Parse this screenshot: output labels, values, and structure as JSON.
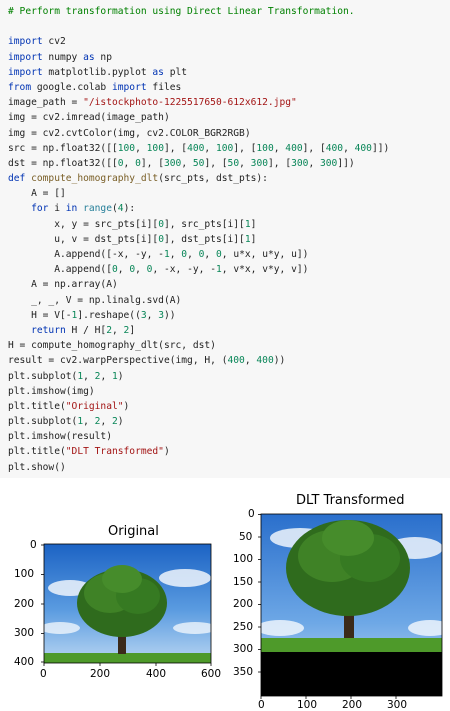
{
  "code": {
    "lines": [
      [
        [
          "com",
          "# Perform transformation using Direct Linear Transformation."
        ]
      ],
      [
        [
          "",
          ""
        ]
      ],
      [
        [
          "kw",
          "import"
        ],
        [
          "",
          " cv2"
        ]
      ],
      [
        [
          "kw",
          "import"
        ],
        [
          "",
          " numpy "
        ],
        [
          "kw",
          "as"
        ],
        [
          "",
          " np"
        ]
      ],
      [
        [
          "kw",
          "import"
        ],
        [
          "",
          " matplotlib.pyplot "
        ],
        [
          "kw",
          "as"
        ],
        [
          "",
          " plt"
        ]
      ],
      [
        [
          "kw",
          "from"
        ],
        [
          "",
          " google.colab "
        ],
        [
          "kw",
          "import"
        ],
        [
          "",
          " files"
        ]
      ],
      [
        [
          "",
          "image_path = "
        ],
        [
          "str",
          "\"/istockphoto-1225517650-612x612.jpg\""
        ]
      ],
      [
        [
          "",
          "img = cv2.imread(image_path)"
        ]
      ],
      [
        [
          "",
          "img = cv2.cvtColor(img, cv2.COLOR_BGR2RGB)"
        ]
      ],
      [
        [
          "",
          "src = np.float32([["
        ],
        [
          "num",
          "100"
        ],
        [
          "",
          ", "
        ],
        [
          "num",
          "100"
        ],
        [
          "",
          "], ["
        ],
        [
          "num",
          "400"
        ],
        [
          "",
          ", "
        ],
        [
          "num",
          "100"
        ],
        [
          "",
          "], ["
        ],
        [
          "num",
          "100"
        ],
        [
          "",
          ", "
        ],
        [
          "num",
          "400"
        ],
        [
          "",
          "], ["
        ],
        [
          "num",
          "400"
        ],
        [
          "",
          ", "
        ],
        [
          "num",
          "400"
        ],
        [
          "",
          "]])"
        ]
      ],
      [
        [
          "",
          "dst = np.float32([["
        ],
        [
          "num",
          "0"
        ],
        [
          "",
          ", "
        ],
        [
          "num",
          "0"
        ],
        [
          "",
          "], ["
        ],
        [
          "num",
          "300"
        ],
        [
          "",
          ", "
        ],
        [
          "num",
          "50"
        ],
        [
          "",
          "], ["
        ],
        [
          "num",
          "50"
        ],
        [
          "",
          ", "
        ],
        [
          "num",
          "300"
        ],
        [
          "",
          "], ["
        ],
        [
          "num",
          "300"
        ],
        [
          "",
          ", "
        ],
        [
          "num",
          "300"
        ],
        [
          "",
          "]])"
        ]
      ],
      [
        [
          "kw",
          "def"
        ],
        [
          "",
          " "
        ],
        [
          "fn",
          "compute_homography_dlt"
        ],
        [
          "",
          "(src_pts, dst_pts):"
        ]
      ],
      [
        [
          "",
          "    A = []"
        ]
      ],
      [
        [
          "",
          "    "
        ],
        [
          "kw",
          "for"
        ],
        [
          "",
          " i "
        ],
        [
          "kw",
          "in"
        ],
        [
          "",
          " "
        ],
        [
          "mod",
          "range"
        ],
        [
          "",
          "("
        ],
        [
          "num",
          "4"
        ],
        [
          "",
          "):"
        ]
      ],
      [
        [
          "",
          "        x, y = src_pts[i]["
        ],
        [
          "num",
          "0"
        ],
        [
          "",
          "], src_pts[i]["
        ],
        [
          "num",
          "1"
        ],
        [
          "",
          "]"
        ]
      ],
      [
        [
          "",
          "        u, v = dst_pts[i]["
        ],
        [
          "num",
          "0"
        ],
        [
          "",
          "], dst_pts[i]["
        ],
        [
          "num",
          "1"
        ],
        [
          "",
          "]"
        ]
      ],
      [
        [
          "",
          "        A.append([-x, -y, -"
        ],
        [
          "num",
          "1"
        ],
        [
          "",
          ", "
        ],
        [
          "num",
          "0"
        ],
        [
          "",
          ", "
        ],
        [
          "num",
          "0"
        ],
        [
          "",
          ", "
        ],
        [
          "num",
          "0"
        ],
        [
          "",
          ", u*x, u*y, u])"
        ]
      ],
      [
        [
          "",
          "        A.append(["
        ],
        [
          "num",
          "0"
        ],
        [
          "",
          ", "
        ],
        [
          "num",
          "0"
        ],
        [
          "",
          ", "
        ],
        [
          "num",
          "0"
        ],
        [
          "",
          ", -x, -y, -"
        ],
        [
          "num",
          "1"
        ],
        [
          "",
          ", v*x, v*y, v])"
        ]
      ],
      [
        [
          "",
          "    A = np.array(A)"
        ]
      ],
      [
        [
          "",
          "    _, _, V = np.linalg.svd(A)"
        ]
      ],
      [
        [
          "",
          "    H = V[-"
        ],
        [
          "num",
          "1"
        ],
        [
          "",
          "].reshape(("
        ],
        [
          "num",
          "3"
        ],
        [
          "",
          ", "
        ],
        [
          "num",
          "3"
        ],
        [
          "",
          "))"
        ]
      ],
      [
        [
          "",
          "    "
        ],
        [
          "kw",
          "return"
        ],
        [
          "",
          " H / H["
        ],
        [
          "num",
          "2"
        ],
        [
          "",
          ", "
        ],
        [
          "num",
          "2"
        ],
        [
          "",
          "]"
        ]
      ],
      [
        [
          "",
          "H = compute_homography_dlt(src, dst)"
        ]
      ],
      [
        [
          "",
          "result = cv2.warpPerspective(img, H, ("
        ],
        [
          "num",
          "400"
        ],
        [
          "",
          ", "
        ],
        [
          "num",
          "400"
        ],
        [
          "",
          "))"
        ]
      ],
      [
        [
          "",
          "plt.subplot("
        ],
        [
          "num",
          "1"
        ],
        [
          "",
          ", "
        ],
        [
          "num",
          "2"
        ],
        [
          "",
          ", "
        ],
        [
          "num",
          "1"
        ],
        [
          "",
          ")"
        ]
      ],
      [
        [
          "",
          "plt.imshow(img)"
        ]
      ],
      [
        [
          "",
          "plt.title("
        ],
        [
          "str",
          "\"Original\""
        ],
        [
          "",
          ")"
        ]
      ],
      [
        [
          "",
          "plt.subplot("
        ],
        [
          "num",
          "1"
        ],
        [
          "",
          ", "
        ],
        [
          "num",
          "2"
        ],
        [
          "",
          ", "
        ],
        [
          "num",
          "2"
        ],
        [
          "",
          ")"
        ]
      ],
      [
        [
          "",
          "plt.imshow(result)"
        ]
      ],
      [
        [
          "",
          "plt.title("
        ],
        [
          "str",
          "\"DLT Transformed\""
        ],
        [
          "",
          ")"
        ]
      ],
      [
        [
          "",
          "plt.show()"
        ]
      ]
    ],
    "colors": {
      "keyword": "#0033b3",
      "string": "#a31515",
      "number": "#098658",
      "comment": "#008000",
      "function": "#795e26",
      "builtin": "#267f99"
    }
  },
  "figure": {
    "left_plot": {
      "title": "Original",
      "x_ticks": [
        "0",
        "200",
        "400",
        "600"
      ],
      "y_ticks": [
        "0",
        "100",
        "200",
        "300",
        "400"
      ],
      "image": "tree-photo"
    },
    "right_plot": {
      "title": "DLT Transformed",
      "x_ticks": [
        "0",
        "100",
        "200",
        "300"
      ],
      "y_ticks": [
        "0",
        "50",
        "100",
        "150",
        "200",
        "250",
        "300",
        "350"
      ],
      "image": "warped-tree-photo",
      "black_region": "bottom"
    }
  }
}
